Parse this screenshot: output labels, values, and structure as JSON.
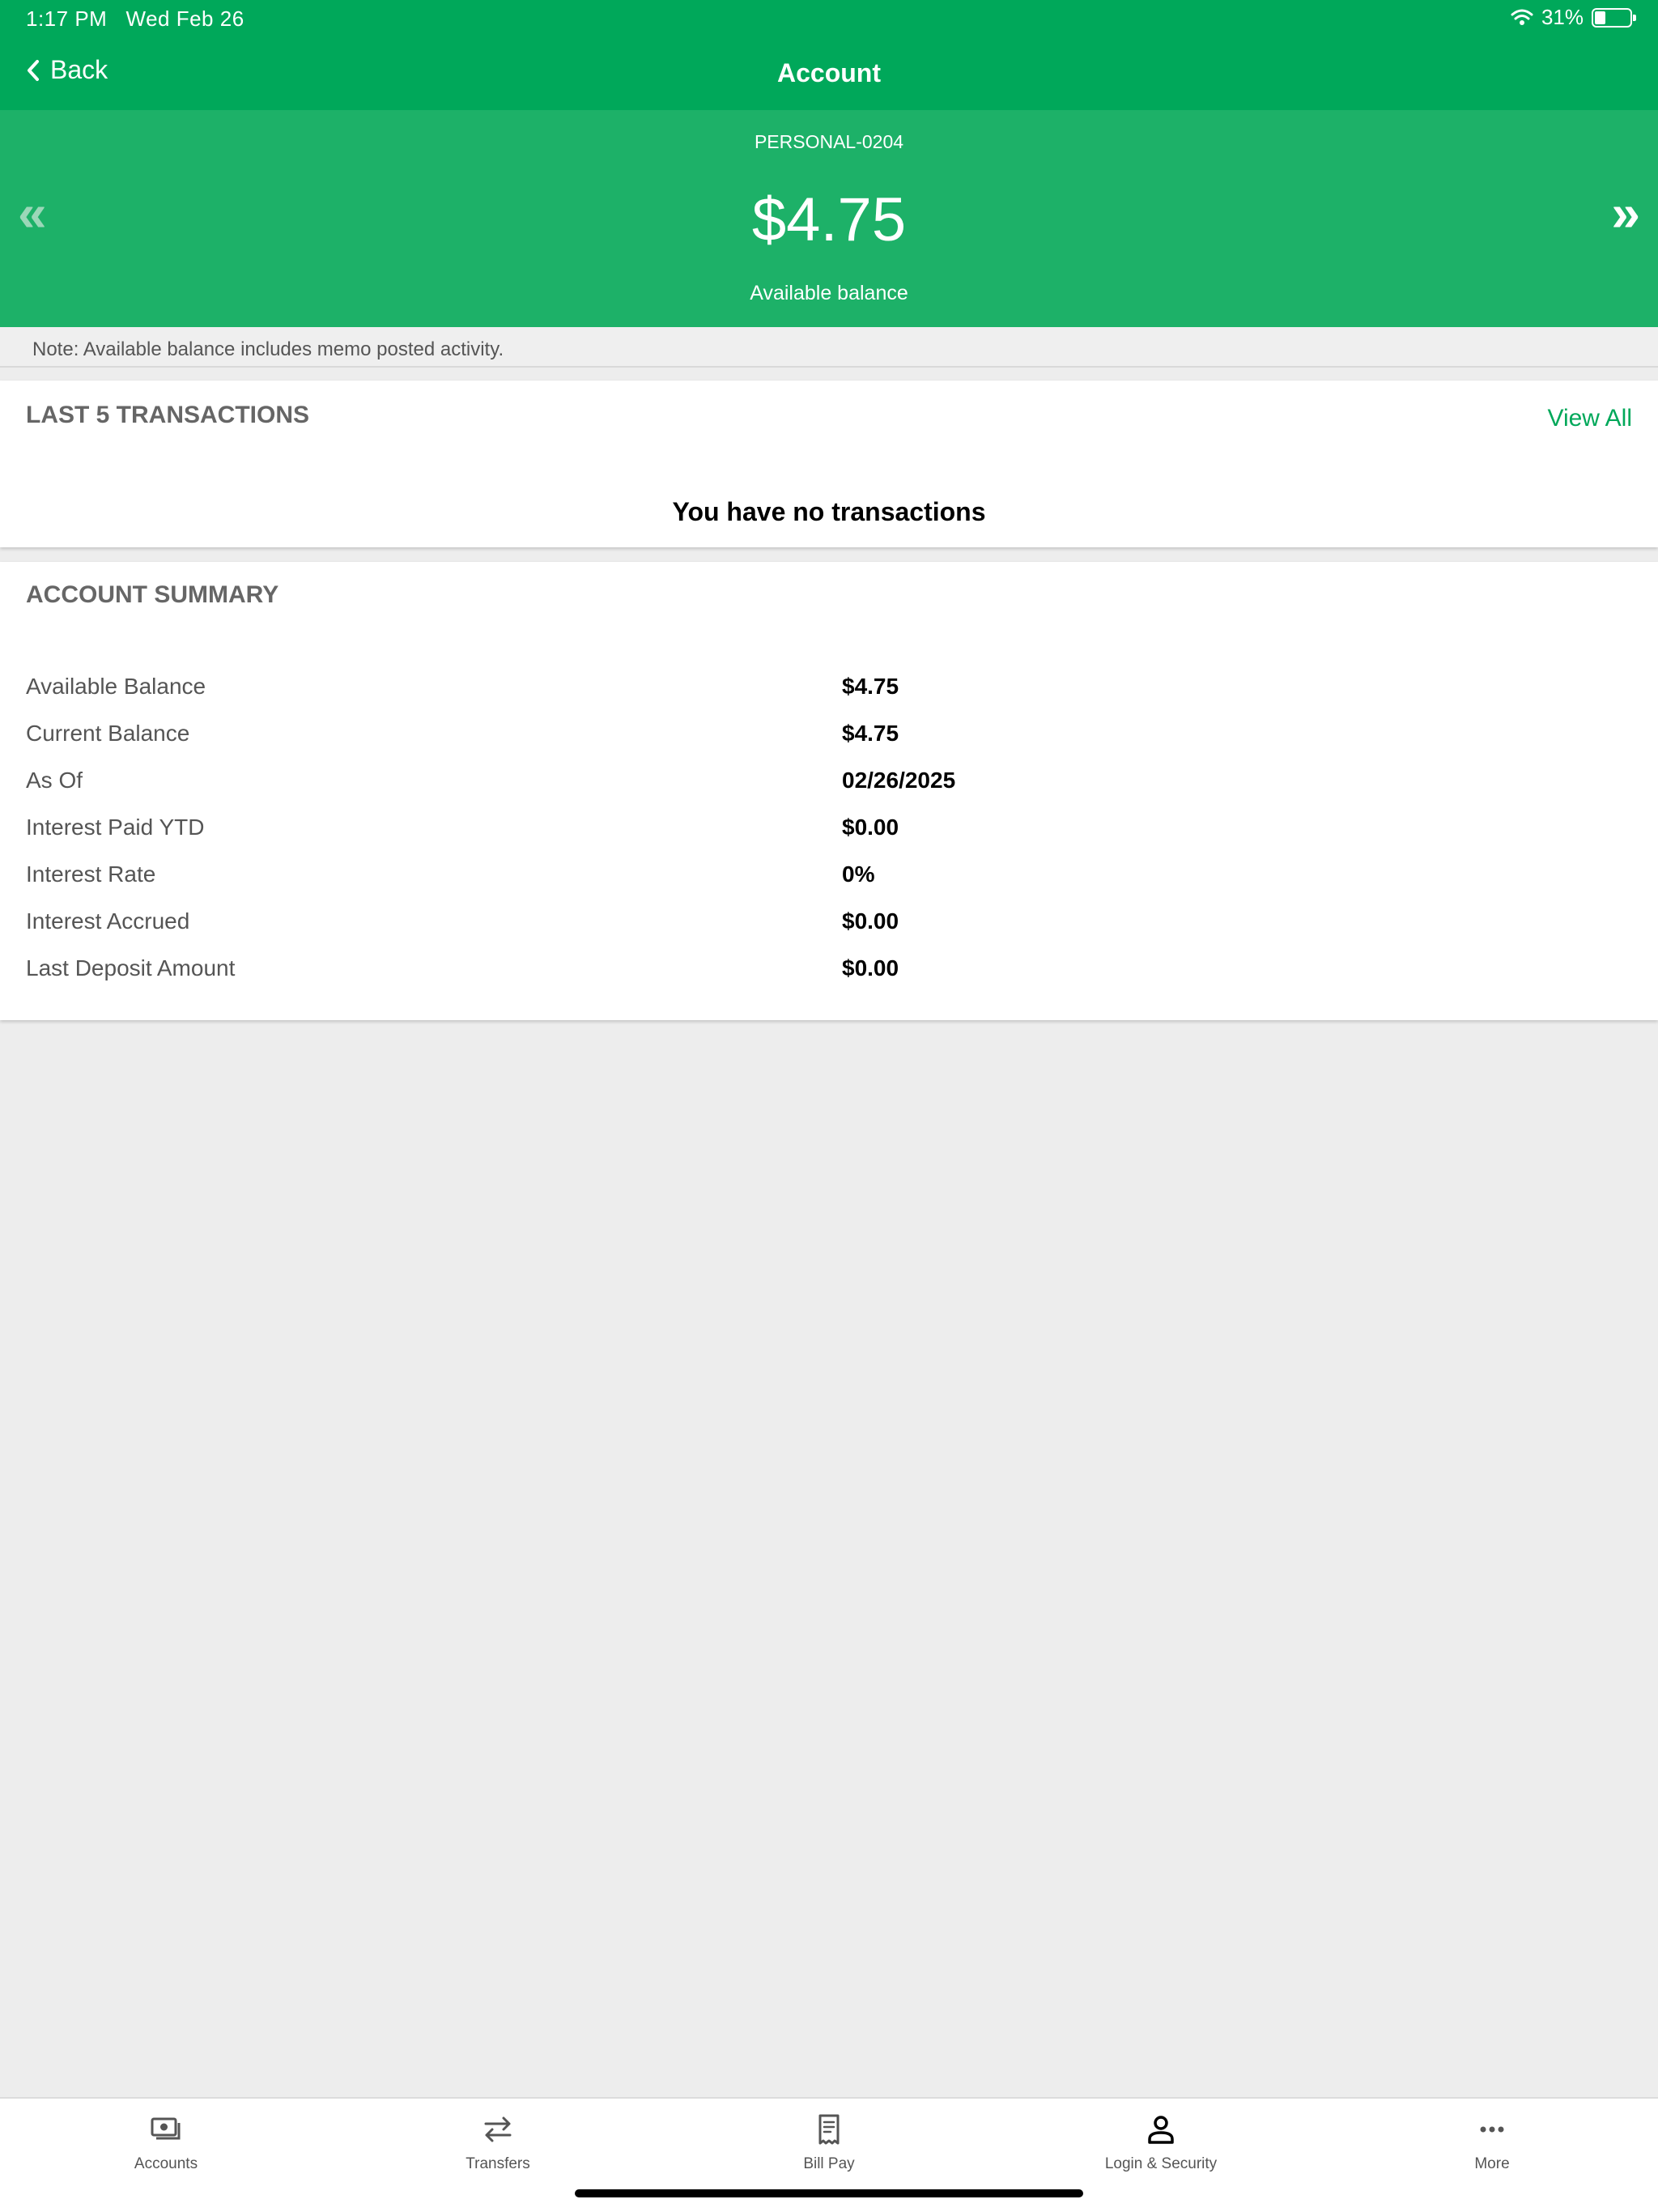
{
  "status_bar": {
    "time": "1:17 PM",
    "date": "Wed Feb 26",
    "battery": "31%",
    "battery_level": 0.31,
    "wifi_icon": "wifi-icon"
  },
  "nav": {
    "back_label": "Back",
    "title": "Account"
  },
  "balance_panel": {
    "account_id": "PERSONAL-0204",
    "amount": "$4.75",
    "label": "Available balance",
    "prev_icon": "«",
    "next_icon": "»"
  },
  "note": "Note: Available balance includes memo posted activity.",
  "transactions": {
    "title": "LAST 5 TRANSACTIONS",
    "view_all": "View All",
    "empty_message": "You have no transactions"
  },
  "summary": {
    "title": "ACCOUNT SUMMARY",
    "rows": [
      {
        "label": "Available Balance",
        "value": "$4.75"
      },
      {
        "label": "Current Balance",
        "value": "$4.75"
      },
      {
        "label": "As Of",
        "value": "02/26/2025"
      },
      {
        "label": "Interest Paid YTD",
        "value": "$0.00"
      },
      {
        "label": "Interest Rate",
        "value": "0%"
      },
      {
        "label": "Interest Accrued",
        "value": "$0.00"
      },
      {
        "label": "Last Deposit Amount",
        "value": "$0.00"
      }
    ]
  },
  "tabs": [
    {
      "label": "Accounts",
      "icon": "accounts-icon"
    },
    {
      "label": "Transfers",
      "icon": "transfers-icon"
    },
    {
      "label": "Bill Pay",
      "icon": "bill-pay-icon"
    },
    {
      "label": "Login & Security",
      "icon": "login-security-icon"
    },
    {
      "label": "More",
      "icon": "more-icon"
    }
  ],
  "colors": {
    "header_green": "#00a85a",
    "panel_green": "#1db168",
    "link_green": "#00a85a",
    "background": "#ededed"
  }
}
